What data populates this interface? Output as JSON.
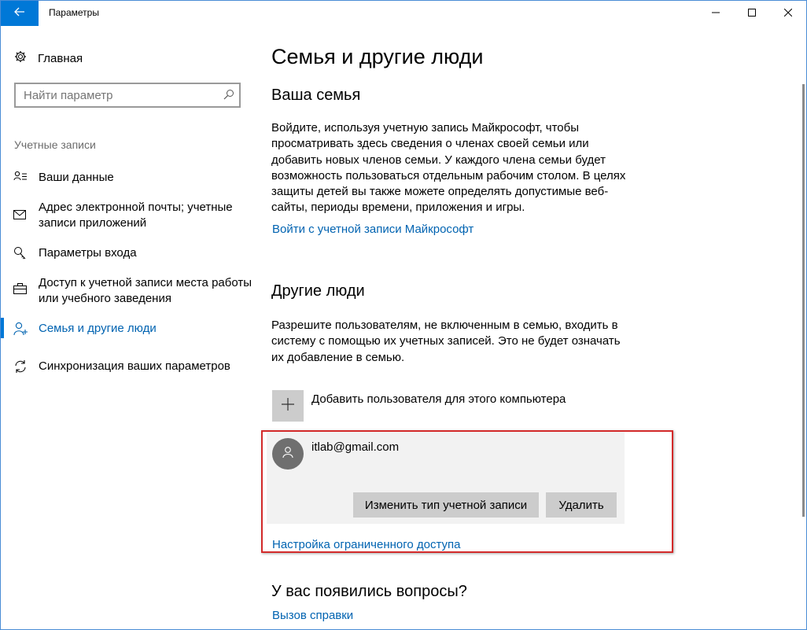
{
  "window": {
    "title": "Параметры"
  },
  "sidebar": {
    "home_label": "Главная",
    "search_placeholder": "Найти параметр",
    "section_label": "Учетные записи",
    "items": [
      {
        "label": "Ваши данные",
        "icon": "user-details-icon"
      },
      {
        "label": "Адрес электронной почты; учетные записи приложений",
        "icon": "mail-icon"
      },
      {
        "label": "Параметры входа",
        "icon": "key-icon"
      },
      {
        "label": "Доступ к учетной записи места работы или учебного заведения",
        "icon": "briefcase-icon"
      },
      {
        "label": "Семья и другие люди",
        "icon": "person-add-icon",
        "active": true
      },
      {
        "label": "Синхронизация ваших параметров",
        "icon": "sync-icon"
      }
    ]
  },
  "main": {
    "title": "Семья и другие люди",
    "family": {
      "heading": "Ваша семья",
      "text": "Войдите, используя учетную запись Майкрософт, чтобы просматривать здесь сведения о членах своей семьи или добавить новых членов семьи. У каждого члена семьи будет возможность пользоваться отдельным рабочим столом. В целях защиты детей вы также можете определять допустимые веб-сайты, периоды времени, приложения и игры.",
      "link": "Войти с учетной записи Майкрософт"
    },
    "others": {
      "heading": "Другие люди",
      "text": "Разрешите пользователям, не включенным в семью, входить в систему с помощью их учетных записей. Это не будет означать их добавление в семью.",
      "add_label": "Добавить пользователя для этого компьютера",
      "account": {
        "email": "itlab@gmail.com",
        "change_type_label": "Изменить тип учетной записи",
        "delete_label": "Удалить"
      },
      "restricted_link": "Настройка ограниченного доступа"
    },
    "questions": {
      "heading": "У вас появились вопросы?",
      "link": "Вызов справки"
    }
  },
  "colors": {
    "accent": "#0078d7",
    "link": "#0063b1",
    "highlight": "#d32a2a"
  }
}
